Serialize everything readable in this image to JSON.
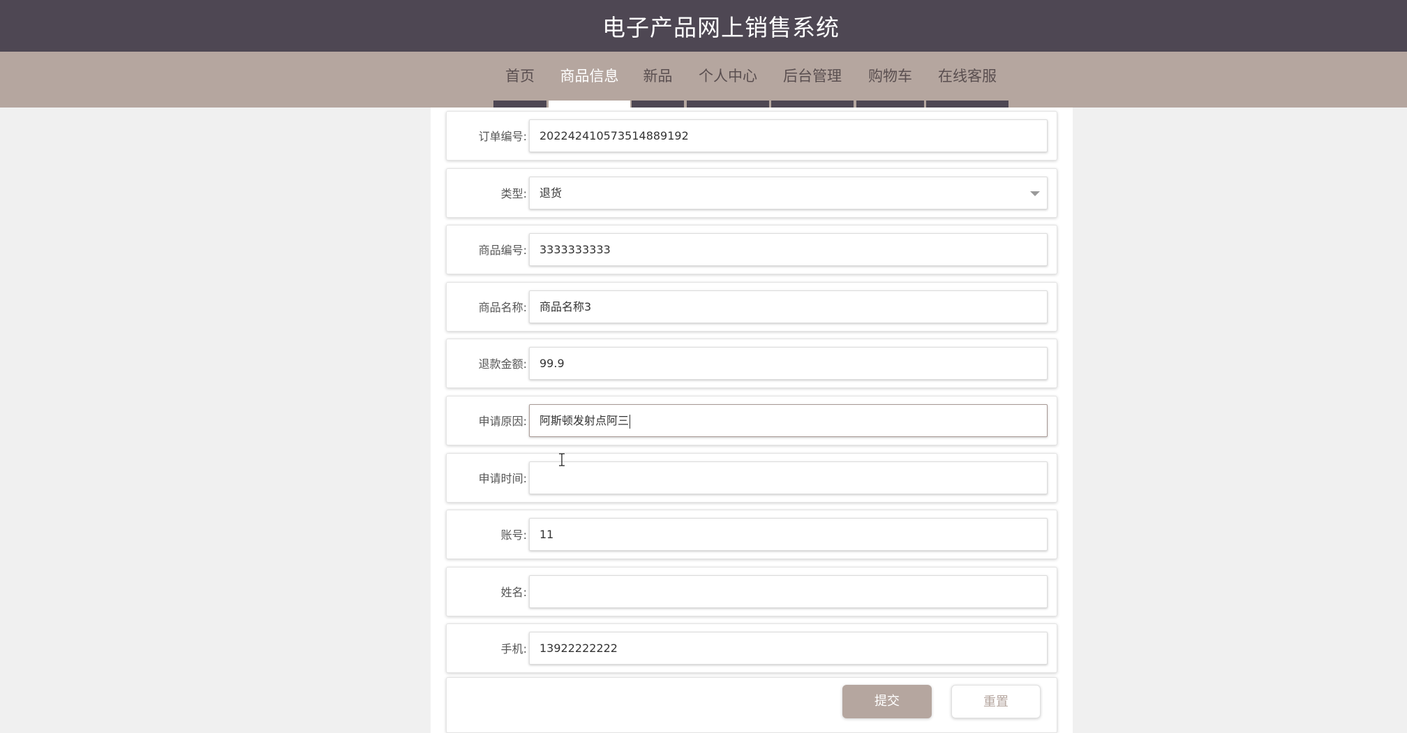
{
  "header": {
    "title": "电子产品网上销售系统"
  },
  "nav": {
    "items": [
      {
        "label": "首页"
      },
      {
        "label": "商品信息"
      },
      {
        "label": "新品"
      },
      {
        "label": "个人中心"
      },
      {
        "label": "后台管理"
      },
      {
        "label": "购物车"
      },
      {
        "label": "在线客服"
      }
    ],
    "active": "商品信息"
  },
  "form": {
    "order_no": {
      "label": "订单编号:",
      "value": "20224241057351488919​2"
    },
    "type": {
      "label": "类型:",
      "value": "退货"
    },
    "product_no": {
      "label": "商品编号:",
      "value": "3333333333"
    },
    "product_name": {
      "label": "商品名称:",
      "value": "商品名称3"
    },
    "refund_amount": {
      "label": "退款金额:",
      "value": "99.9"
    },
    "reason": {
      "label": "申请原因:",
      "value": "阿斯顿发射点阿三"
    },
    "apply_time": {
      "label": "申请时间:",
      "value": ""
    },
    "account": {
      "label": "账号:",
      "value": "11"
    },
    "name": {
      "label": "姓名:",
      "value": ""
    },
    "phone": {
      "label": "手机:",
      "value": "13922222222"
    }
  },
  "actions": {
    "submit_label": "提交",
    "reset_label": "重置"
  },
  "colors": {
    "header_bg": "#4e4753",
    "nav_bg": "#b5a69f",
    "accent": "#b5a69f"
  }
}
